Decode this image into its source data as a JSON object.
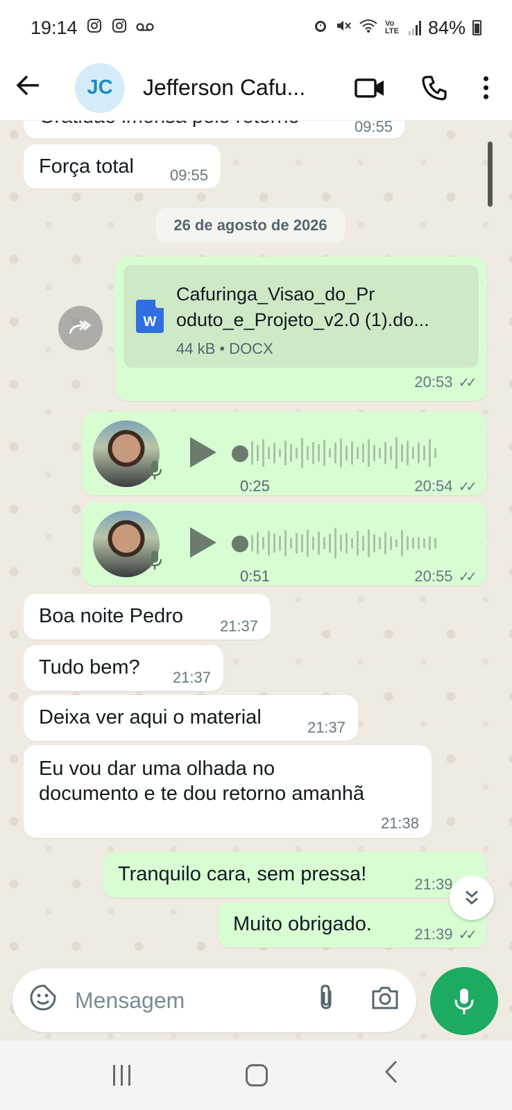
{
  "status_bar": {
    "time": "19:14",
    "battery": "84%",
    "left_icons": [
      "instagram-icon",
      "instagram-icon",
      "voicemail-icon"
    ],
    "right_icons": [
      "alarm-icon",
      "mute-icon",
      "wifi-icon",
      "volte-icon",
      "signal-icon",
      "battery-icon"
    ],
    "volte_label": "Vo LTE"
  },
  "header": {
    "avatar_initials": "JC",
    "contact_name": "Jefferson Cafu...",
    "icons": [
      "back-arrow-icon",
      "video-call-icon",
      "phone-icon",
      "more-icon"
    ]
  },
  "chat": {
    "partial_top": {
      "text": "Gratidão imensa pelo retorno",
      "time": "09:55"
    },
    "messages_before_date": [
      {
        "text": "Força total",
        "time": "09:55"
      }
    ],
    "date_chip": "26 de agosto de 2026",
    "document": {
      "name_line1": "Cafuringa_Visao_do_Pr",
      "name_line2": "oduto_e_Projeto_v2.0 (1).do...",
      "icon_letter": "W",
      "meta": "44 kB • DOCX",
      "time": "20:53",
      "ticks": "✓✓"
    },
    "voice_notes": [
      {
        "duration": "0:25",
        "time": "20:54",
        "ticks": "✓✓"
      },
      {
        "duration": "0:51",
        "time": "20:55",
        "ticks": "✓✓"
      }
    ],
    "incoming": [
      {
        "text": "Boa noite Pedro",
        "time": "21:37"
      },
      {
        "text": "Tudo bem?",
        "time": "21:37"
      },
      {
        "text": "Deixa ver aqui o material",
        "time": "21:37"
      },
      {
        "text_line1": "Eu vou dar uma olhada no",
        "text_line2": "documento e te dou retorno amanhã",
        "time": "21:38"
      }
    ],
    "outgoing": [
      {
        "text": "Tranquilo cara, sem pressa!",
        "time": "21:39",
        "ticks": "✓✓"
      },
      {
        "text": "Muito obrigado.",
        "time": "21:39",
        "ticks": "✓✓"
      }
    ]
  },
  "composer": {
    "placeholder": "Mensagem",
    "icons": [
      "sticker-icon",
      "attach-icon",
      "camera-icon",
      "mic-icon"
    ]
  },
  "colors": {
    "outgoing_bubble": "#d9fdd3",
    "incoming_bubble": "#ffffff",
    "chat_background": "#efeae2",
    "accent_green": "#1daa61",
    "avatar_bg": "#d4ecf8"
  }
}
